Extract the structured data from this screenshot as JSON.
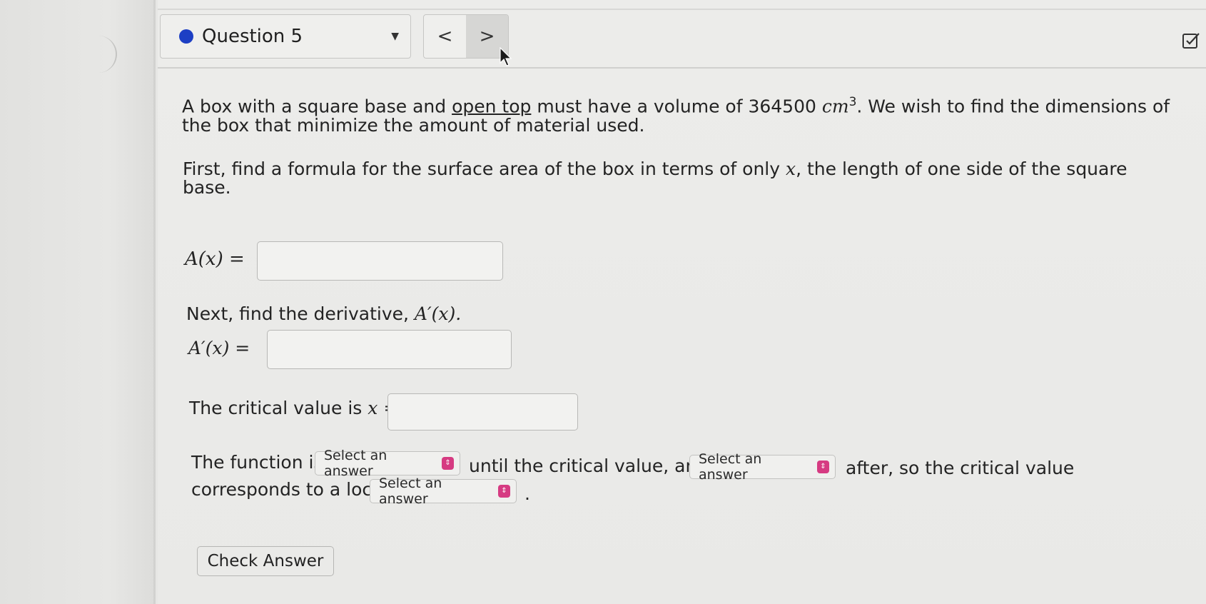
{
  "header": {
    "question_title": "Question 5",
    "prev_label": "<",
    "next_label": ">",
    "status_color": "#1d3fc4"
  },
  "problem": {
    "line1_pre": "A box with a square base and ",
    "line1_underlined": "open top",
    "line1_mid": " must have a volume of 364500 ",
    "unit": "cm",
    "unit_exp": "3",
    "line1_post": ". We wish to find the dimensions of",
    "line2": "the box that minimize the amount of material used.",
    "para2_line1_pre": "First, find a formula for the surface area of the box in terms of only ",
    "para2_var": "x",
    "para2_line1_post": ", the length of one side of the square",
    "para2_line2": "base."
  },
  "area_label": "A(x) =",
  "derivative_prompt": "Next, find the derivative, ",
  "derivative_prompt_math": "A′(x).",
  "derivative_label": "A′(x) =",
  "critical_label_text": "The critical value is ",
  "critical_label_math": "x =",
  "function_sentence": {
    "part1": "The function is",
    "part2": "until the critical value, and",
    "part3": "after, so the critical value",
    "part4": "corresponds to a local",
    "part5": "."
  },
  "selects": {
    "first": "Select an answer",
    "second": "Select an answer",
    "third": "Select an answer"
  },
  "check_answer_label": "Check Answer",
  "icons": {
    "status": "status-dot-icon",
    "dropdown": "caret-down-icon",
    "cursor": "mouse-pointer-icon",
    "review": "checkbox-edit-icon"
  }
}
